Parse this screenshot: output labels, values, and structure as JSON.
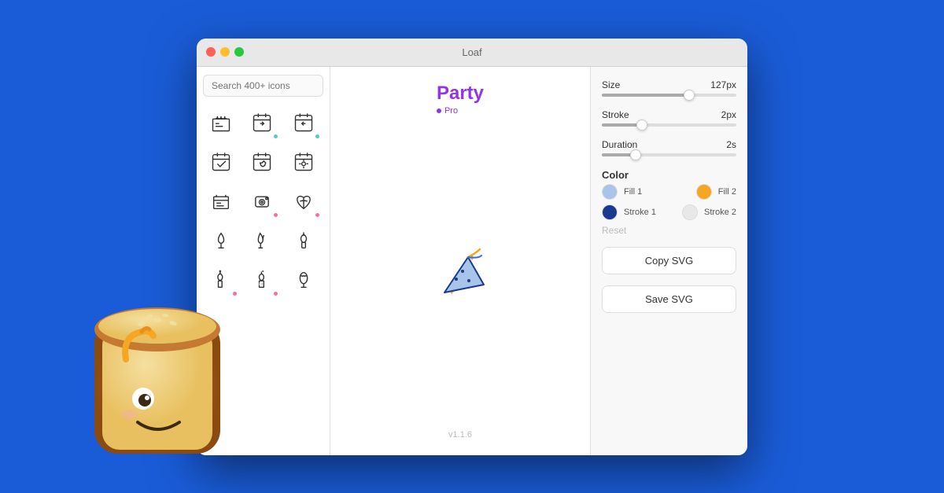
{
  "window": {
    "title": "Loaf",
    "version": "v1.1.6"
  },
  "sidebar": {
    "search_placeholder": "Search 400+ icons",
    "icons": [
      {
        "name": "birthday-cake",
        "dot": "none"
      },
      {
        "name": "arrow-right-calendar",
        "dot": "teal"
      },
      {
        "name": "arrow-left-calendar",
        "dot": "teal"
      },
      {
        "name": "checkbox",
        "dot": "none"
      },
      {
        "name": "heart-calendar",
        "dot": "none"
      },
      {
        "name": "settings-calendar",
        "dot": "none"
      },
      {
        "name": "list",
        "dot": "none"
      },
      {
        "name": "camera",
        "dot": "pink"
      },
      {
        "name": "campfire",
        "dot": "pink"
      },
      {
        "name": "flame1",
        "dot": "none"
      },
      {
        "name": "flame2",
        "dot": "none"
      },
      {
        "name": "candle1",
        "dot": "none"
      },
      {
        "name": "candle2",
        "dot": "pink"
      },
      {
        "name": "candle3",
        "dot": "pink"
      },
      {
        "name": "bottle",
        "dot": "none"
      }
    ]
  },
  "main": {
    "icon_name": "Party",
    "pro_label": "Pro",
    "version": "v1.1.6"
  },
  "properties": {
    "size_label": "Size",
    "size_value": "127px",
    "size_percent": 65,
    "stroke_label": "Stroke",
    "stroke_value": "2px",
    "stroke_percent": 30,
    "duration_label": "Duration",
    "duration_value": "2s",
    "duration_percent": 25
  },
  "colors": {
    "section_label": "Color",
    "fill1_label": "Fill 1",
    "fill1_color": "#a8c4e8",
    "fill2_label": "Fill 2",
    "fill2_color": "#f5a623",
    "stroke1_label": "Stroke 1",
    "stroke1_color": "#1a3a8f",
    "stroke2_label": "Stroke 2",
    "stroke2_color": "#e8e8e8",
    "reset_label": "Reset"
  },
  "actions": {
    "copy_svg_label": "Copy SVG",
    "save_svg_label": "Save SVG"
  }
}
